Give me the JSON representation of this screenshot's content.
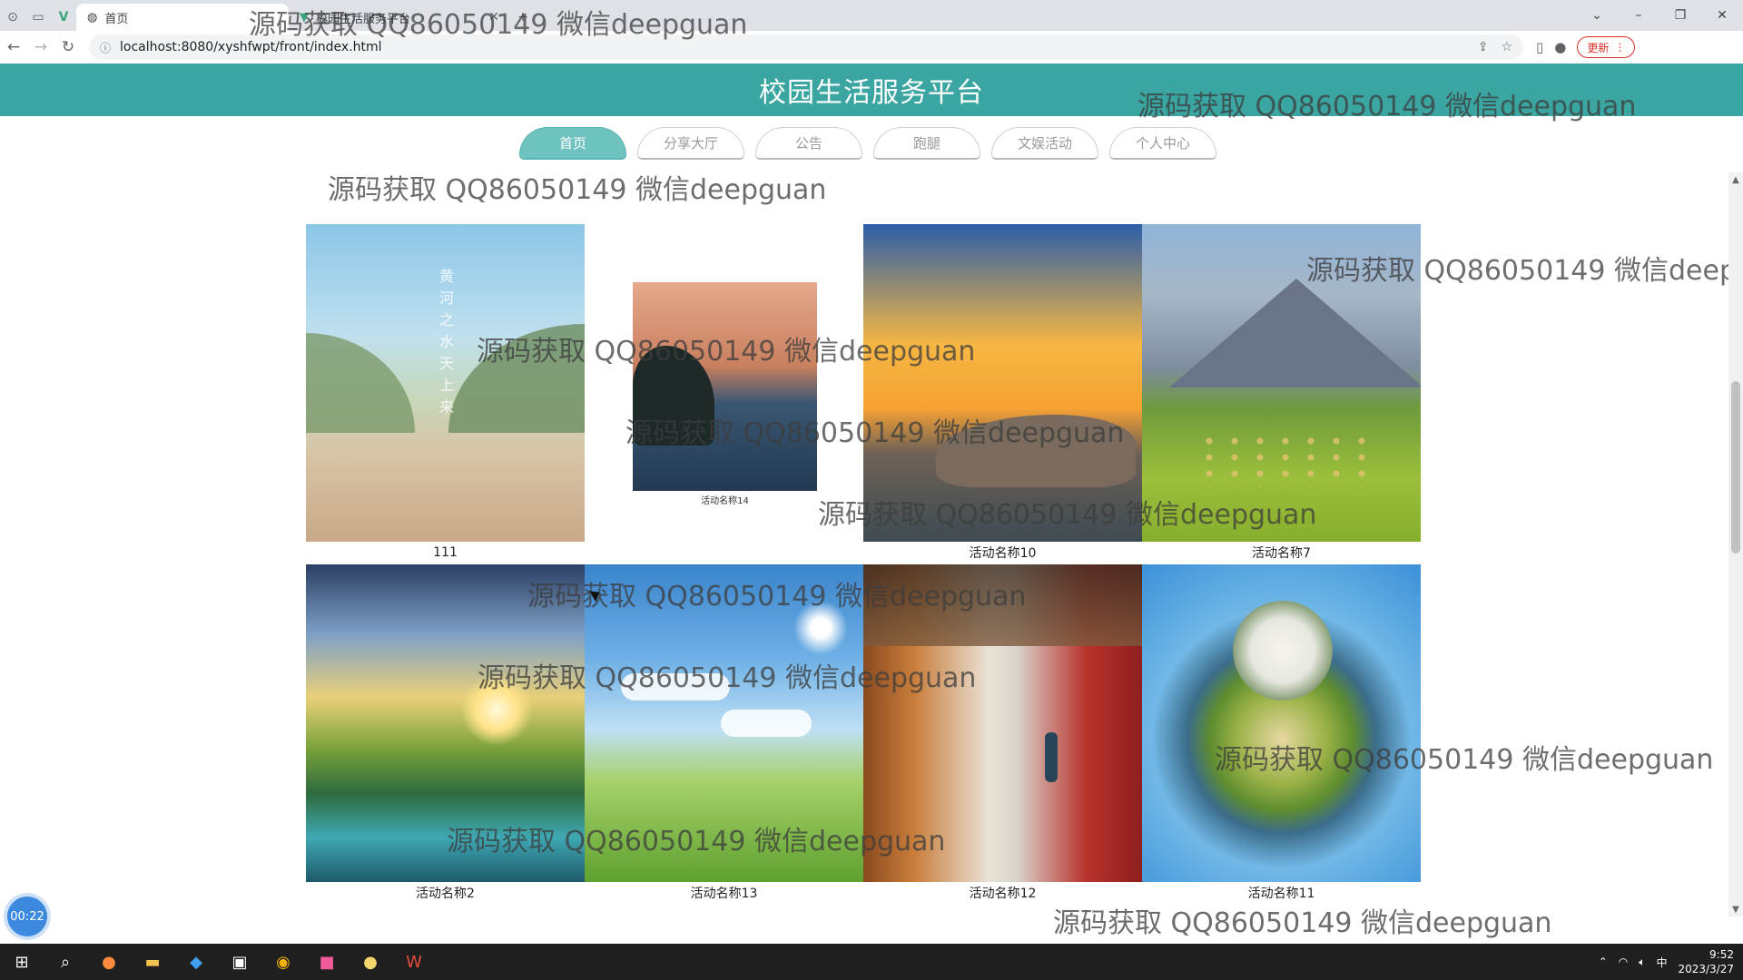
{
  "browser": {
    "tabs": [
      {
        "label": "首页",
        "active": true
      },
      {
        "label": "校园生活服务平台",
        "active": false
      }
    ],
    "url": "localhost:8080/xyshfwpt/front/index.html",
    "update_label": "更新"
  },
  "header": {
    "title": "校园生活服务平台"
  },
  "nav": {
    "items": [
      {
        "label": "首页"
      },
      {
        "label": "分享大厅"
      },
      {
        "label": "公告"
      },
      {
        "label": "跑腿"
      },
      {
        "label": "文娱活动"
      },
      {
        "label": "个人中心"
      }
    ]
  },
  "activities": {
    "row1": [
      {
        "caption": "111",
        "icon": "river-image-icon"
      },
      {
        "caption": "活动名称14",
        "icon": "lake-sunset-image-icon"
      },
      {
        "caption": "活动名称10",
        "icon": "sunset-image-icon"
      },
      {
        "caption": "活动名称7",
        "icon": "mountain-meadow-image-icon"
      }
    ],
    "row2": [
      {
        "caption": "活动名称2",
        "icon": "forest-lake-image-icon"
      },
      {
        "caption": "活动名称13",
        "icon": "meadow-sky-image-icon"
      },
      {
        "caption": "活动名称12",
        "icon": "corridor-image-icon"
      },
      {
        "caption": "活动名称11",
        "icon": "tiny-planet-image-icon"
      }
    ],
    "river_poem": "黄河之水天上来"
  },
  "watermark": "源码获取 QQ86050149 微信deepguan",
  "timer": "00:22",
  "taskbar": {
    "time": "9:52",
    "date": "2023/3/27",
    "ime": "中"
  },
  "colors": {
    "header_bg": "#3aa5a1",
    "nav_active": "#6ec2bf"
  }
}
